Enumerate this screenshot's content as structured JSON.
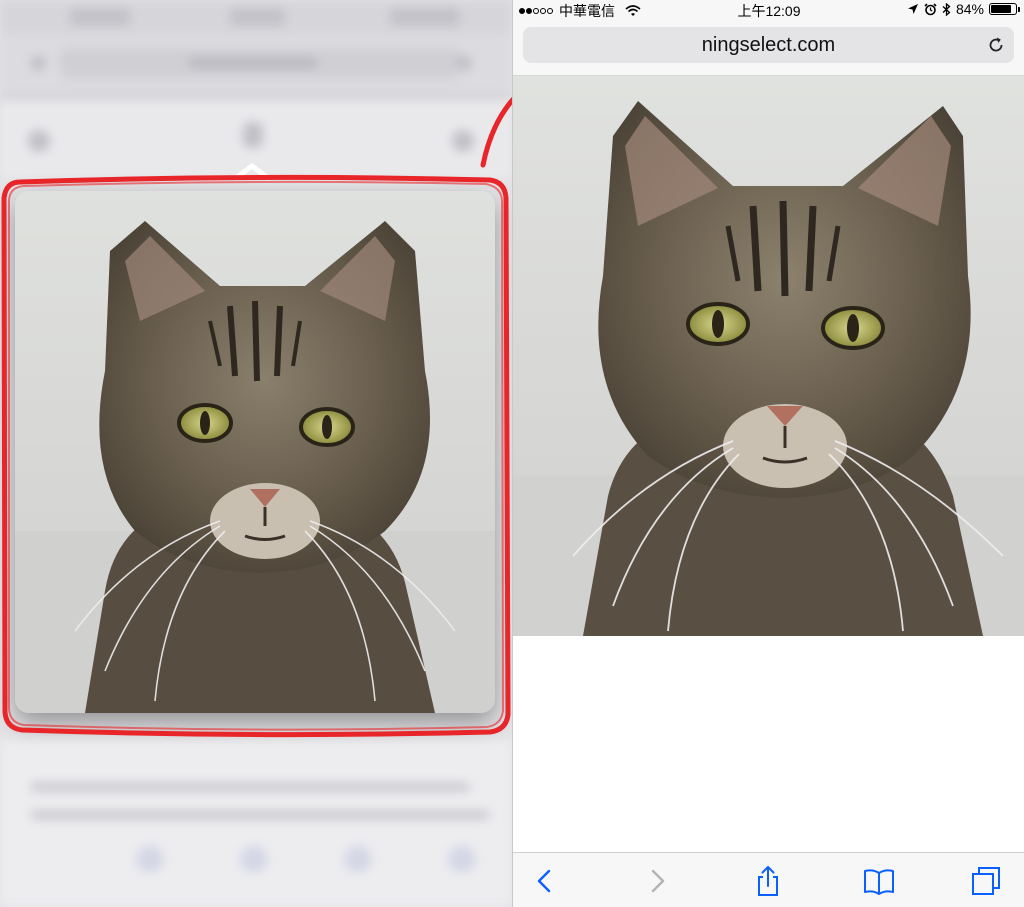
{
  "status_bar": {
    "carrier": "中華電信",
    "time": "上午12:09",
    "battery_percent": "84%",
    "battery_level": 0.84
  },
  "safari": {
    "url": "ningselect.com"
  },
  "toolbar": {
    "items": [
      "back-icon",
      "forward-icon",
      "share-icon",
      "bookmarks-icon",
      "tabs-icon"
    ]
  },
  "colors": {
    "annotation_red": "#e8262a",
    "ios_blue": "#0a60ff",
    "disabled_gray": "#b4b4b8"
  }
}
